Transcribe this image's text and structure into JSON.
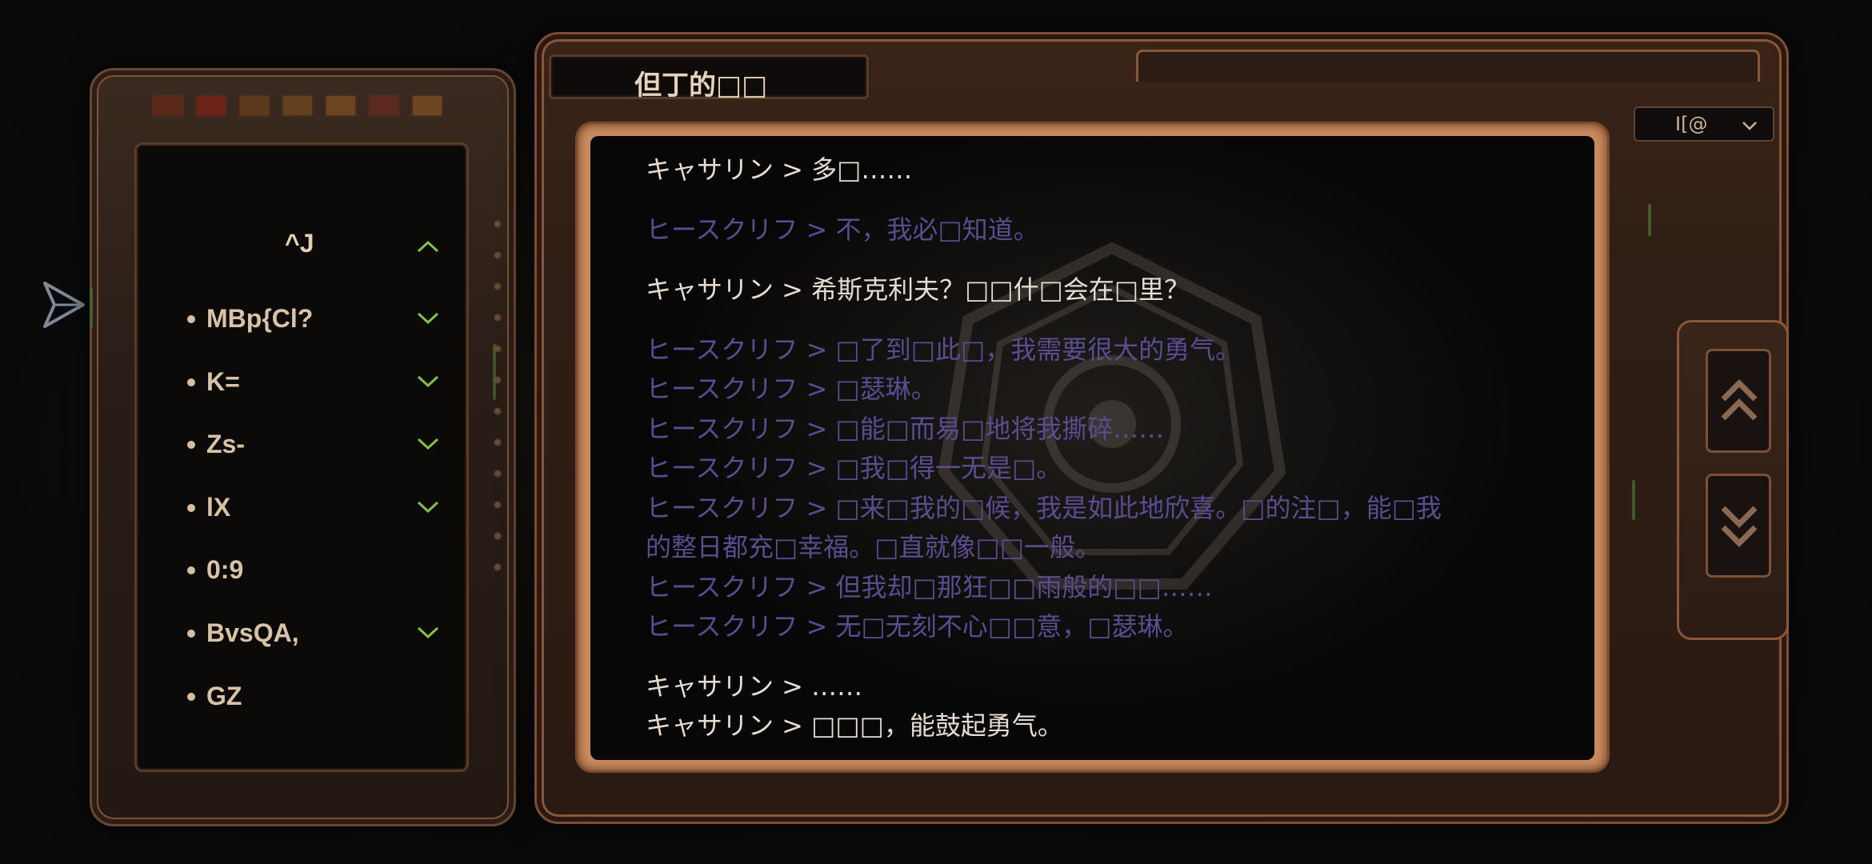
{
  "window": {
    "title": "但丁的□□"
  },
  "selector": {
    "value": "I[@"
  },
  "sidebar": {
    "header_label": "^J",
    "items": [
      {
        "label": "MBp{Cl?",
        "has_chevron": true
      },
      {
        "label": "K=",
        "has_chevron": true
      },
      {
        "label": "Zs-",
        "has_chevron": true
      },
      {
        "label": "lX",
        "has_chevron": true
      },
      {
        "label": "0:9",
        "has_chevron": false
      },
      {
        "label": "BvsQA,",
        "has_chevron": true
      },
      {
        "label": "GZ",
        "has_chevron": false
      }
    ]
  },
  "dialog": {
    "lines": [
      {
        "speaker": "cath",
        "text": "キャサリン > 多□……"
      },
      {
        "speaker": "heath",
        "text": "ヒースクリフ > 不，我必□知道。"
      },
      {
        "speaker": "cath",
        "text": "キャサリン > 希斯克利夫？□□什□会在□里？"
      },
      {
        "speaker": "heath",
        "text": "ヒースクリフ > □了到□此□，我需要很大的勇气。"
      },
      {
        "speaker": "heath",
        "text": "ヒースクリフ > □瑟琳。"
      },
      {
        "speaker": "heath",
        "text": "ヒースクリフ > □能□而易□地将我撕碎……"
      },
      {
        "speaker": "heath",
        "text": "ヒースクリフ > □我□得一无是□。"
      },
      {
        "speaker": "heath",
        "text": "ヒースクリフ > □来□我的□候，我是如此地欣喜。□的注□，能□我"
      },
      {
        "speaker": "heath",
        "text": "的整日都充□幸福。□直就像□□一般。"
      },
      {
        "speaker": "heath",
        "text": "ヒースクリフ > 但我却□那狂□□雨般的□□……"
      },
      {
        "speaker": "heath",
        "text": "ヒースクリフ > 无□无刻不心□□意，□瑟琳。"
      },
      {
        "speaker": "cath",
        "text": "キャサリン > ……"
      },
      {
        "speaker": "cath",
        "text": "キャサリン > □□□，能鼓起勇气。"
      }
    ]
  },
  "colors": {
    "cath_text": "#e6dcd0",
    "heath_text": "#5a4c8f",
    "chevron": "#86c04a",
    "frame": "#8a5839"
  },
  "icons": {
    "sidebar_header": "chevron-up-icon",
    "sidebar_item": "chevron-down-icon",
    "scroll_up": "double-chevron-up-icon",
    "scroll_down": "double-chevron-down-icon",
    "side": "paper-plane-icon"
  }
}
